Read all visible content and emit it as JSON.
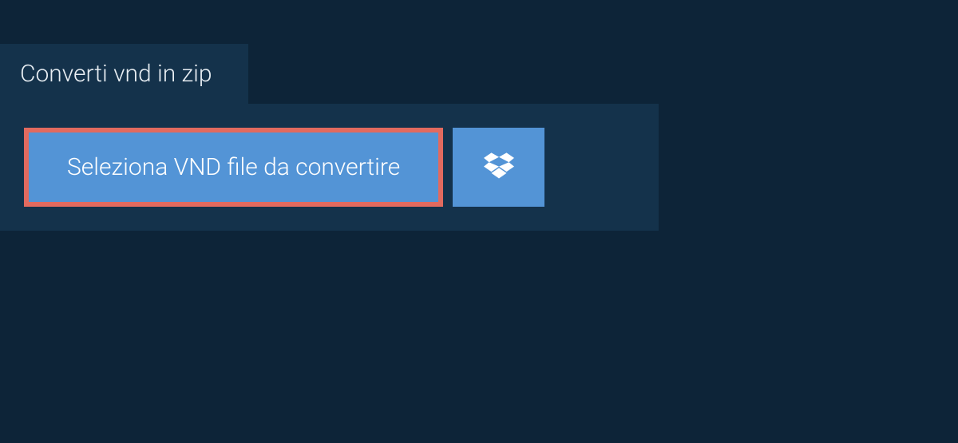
{
  "tab": {
    "title": "Converti vnd in zip"
  },
  "buttons": {
    "select_label": "Seleziona VND file da convertire"
  }
}
